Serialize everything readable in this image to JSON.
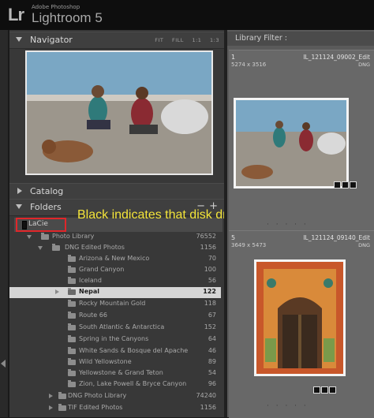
{
  "app": {
    "logo": "Lr",
    "vendor": "Adobe Photoshop",
    "name": "Lightroom 5"
  },
  "navigator": {
    "title": "Navigator",
    "options": [
      "FIT",
      "FILL",
      "1:1",
      "1:3"
    ]
  },
  "catalog": {
    "title": "Catalog"
  },
  "folders": {
    "title": "Folders",
    "minus": "−",
    "plus": "+",
    "drive": "LaCie",
    "items": [
      {
        "label": "Photo Library",
        "count": "76552"
      },
      {
        "label": "DNG Edited Photos",
        "count": "1156"
      },
      {
        "label": "Arizona & New Mexico",
        "count": "70"
      },
      {
        "label": "Grand Canyon",
        "count": "100"
      },
      {
        "label": "Iceland",
        "count": "56"
      },
      {
        "label": "Nepal",
        "count": "122"
      },
      {
        "label": "Rocky Mountain Gold",
        "count": "118"
      },
      {
        "label": "Route 66",
        "count": "67"
      },
      {
        "label": "South Atlantic & Antarctica",
        "count": "152"
      },
      {
        "label": "Spring in the Canyons",
        "count": "64"
      },
      {
        "label": "White Sands & Bosque del Apache",
        "count": "46"
      },
      {
        "label": "Wild Yellowstone",
        "count": "89"
      },
      {
        "label": "Yellowstone & Grand Teton",
        "count": "54"
      },
      {
        "label": "Zion, Lake Powell & Bryce Canyon",
        "count": "96"
      },
      {
        "label": "DNG Photo Library",
        "count": "74240"
      },
      {
        "label": "TIF Edited Photos",
        "count": "1156"
      }
    ]
  },
  "annotation": "Black indicates that disk drive is off-line",
  "library_filter": "Library Filter :",
  "grid": [
    {
      "index": "1",
      "dimensions": "5274 x 3516",
      "filename": "IL_121124_09002_Edit",
      "format": "DNG"
    },
    {
      "index": "5",
      "dimensions": "3649 x 5473",
      "filename": "IL_121124_09140_Edit",
      "format": "DNG"
    }
  ],
  "colors": {
    "annotation": "#f4e53a",
    "highlight_box": "#e0262a",
    "selected_row": "#d5d5d5"
  }
}
